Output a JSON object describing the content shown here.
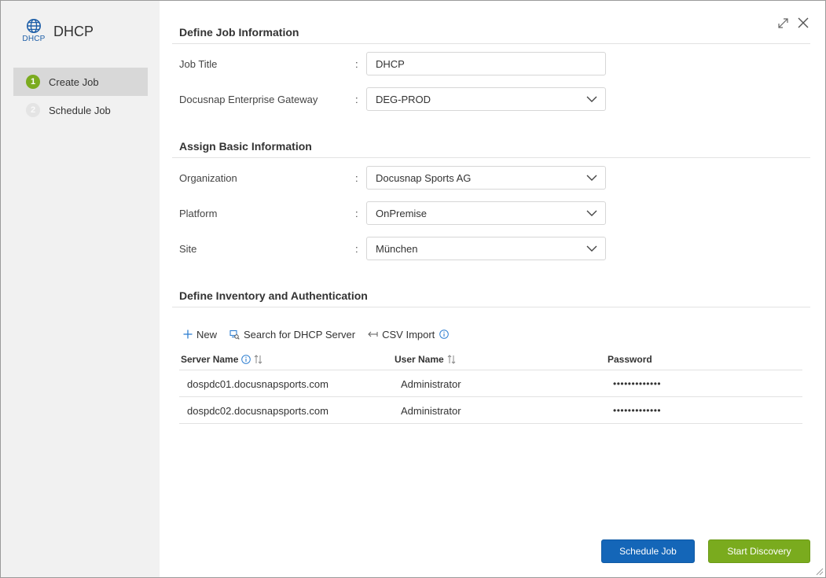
{
  "app": {
    "title": "DHCP",
    "icon_label": "DHCP",
    "icon": "globe-icon"
  },
  "steps": [
    {
      "number": "1",
      "label": "Create Job",
      "active": true
    },
    {
      "number": "2",
      "label": "Schedule Job",
      "active": false
    }
  ],
  "window_actions": {
    "expand_icon": "expand-icon",
    "close_icon": "close-icon"
  },
  "sections": {
    "job_info": "Define Job Information",
    "basic_info": "Assign Basic Information",
    "inventory": "Define Inventory and Authentication"
  },
  "fields": {
    "job_title": {
      "label": "Job Title",
      "value": "DHCP"
    },
    "gateway": {
      "label": "Docusnap Enterprise Gateway",
      "value": "DEG-PROD"
    },
    "organization": {
      "label": "Organization",
      "value": "Docusnap Sports AG"
    },
    "platform": {
      "label": "Platform",
      "value": "OnPremise"
    },
    "site": {
      "label": "Site",
      "value": "München"
    }
  },
  "colon": ":",
  "toolbar": {
    "new": "New",
    "search": "Search for DHCP Server",
    "csv": "CSV Import"
  },
  "table": {
    "headers": {
      "server": "Server Name",
      "user": "User Name",
      "password": "Password"
    },
    "rows": [
      {
        "server": "dospdc01.docusnapsports.com",
        "user": "Administrator",
        "password": "•••••••••••••"
      },
      {
        "server": "dospdc02.docusnapsports.com",
        "user": "Administrator",
        "password": "•••••••••••••"
      }
    ]
  },
  "buttons": {
    "schedule": "Schedule Job",
    "start": "Start Discovery"
  },
  "colors": {
    "accent_green": "#7aab1e",
    "accent_blue": "#1466b8",
    "info_blue": "#2f7fd1"
  }
}
